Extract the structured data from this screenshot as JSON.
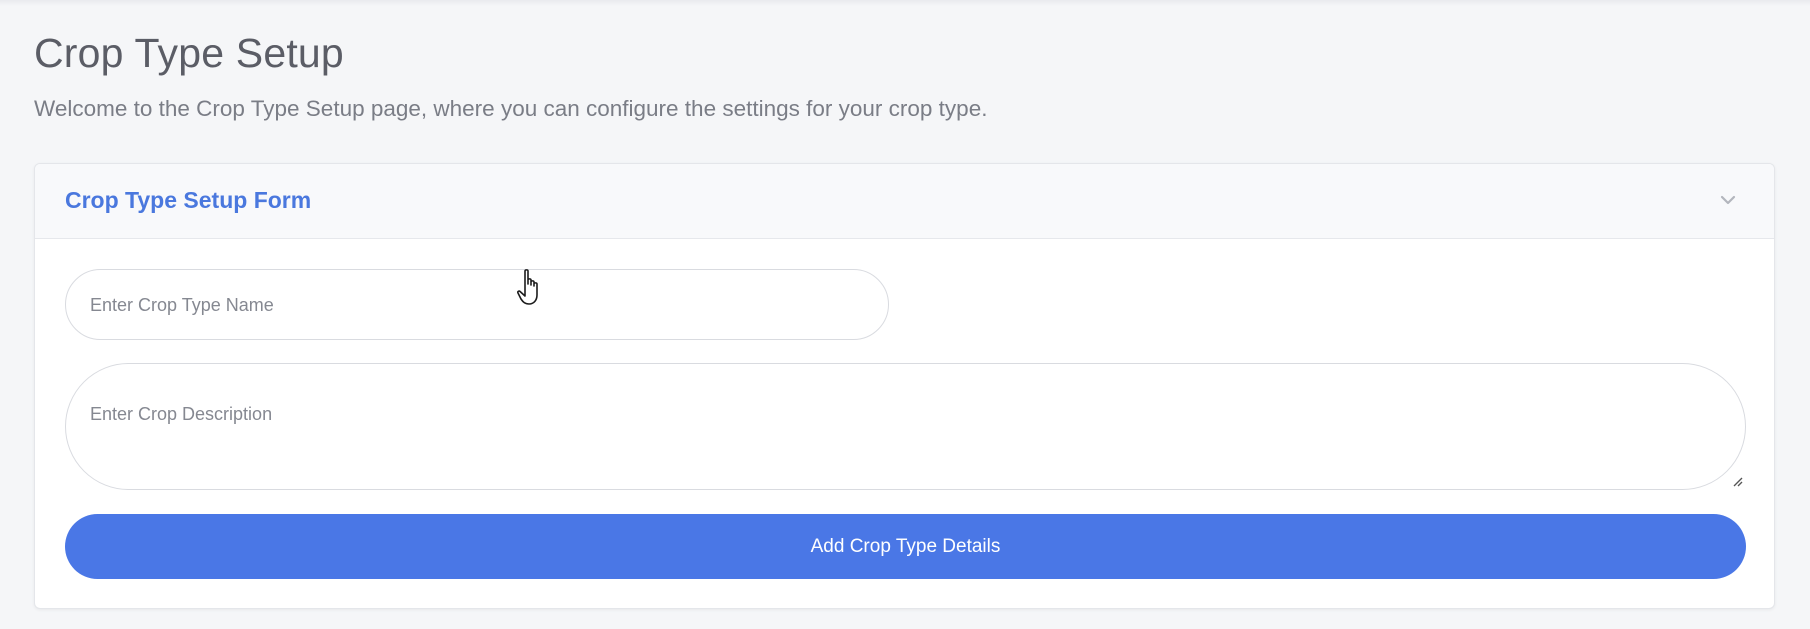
{
  "page": {
    "title": "Crop Type Setup",
    "subtitle": "Welcome to the Crop Type Setup page, where you can configure the settings for your crop type."
  },
  "form_card": {
    "title": "Crop Type Setup Form",
    "collapse_icon": "chevron-down-icon",
    "fields": {
      "crop_type_name": {
        "value": "",
        "placeholder": "Enter Crop Type Name"
      },
      "crop_description": {
        "value": "",
        "placeholder": "Enter Crop Description"
      }
    },
    "submit_label": "Add Crop Type Details"
  },
  "colors": {
    "accent": "#4a78de",
    "button_bg": "#4a77e6",
    "page_bg": "#f5f6f8"
  },
  "cursor": {
    "icon": "hand-pointer-icon"
  }
}
